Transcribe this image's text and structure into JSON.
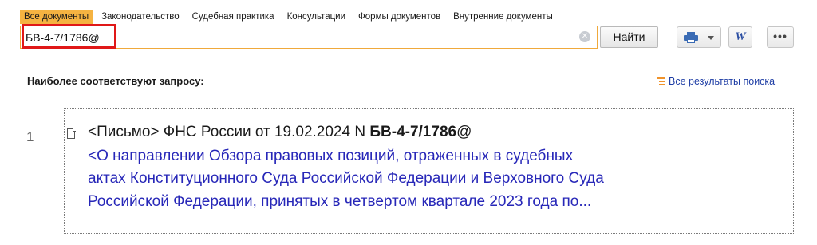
{
  "tabs": [
    {
      "label": "Все документы",
      "active": true
    },
    {
      "label": "Законодательство",
      "active": false
    },
    {
      "label": "Судебная практика",
      "active": false
    },
    {
      "label": "Консультации",
      "active": false
    },
    {
      "label": "Формы документов",
      "active": false
    },
    {
      "label": "Внутренние документы",
      "active": false
    }
  ],
  "search": {
    "value": "БВ-4-7/1786@",
    "button_label": "Найти",
    "clear_symbol": "✕"
  },
  "toolbar": {
    "print_icon": "printer-icon",
    "word_icon_label": "W",
    "more_label": "•••"
  },
  "results": {
    "section_title": "Наиболее соответствуют запросу:",
    "all_results_label": "Все результаты поиска",
    "items": [
      {
        "number": "1",
        "title_prefix": "<Письмо> ФНС России от 19.02.2024 N ",
        "title_bold": "БВ-4-7/1786",
        "title_suffix": "@",
        "description_lines": [
          "<О направлении Обзора правовых позиций, отраженных в судебных",
          "актах Конституционного Суда Российской Федерации и Верховного Суда",
          "Российской Федерации, принятых в четвертом квартале 2023 года по..."
        ]
      }
    ]
  },
  "colors": {
    "accent": "#f5b341",
    "highlight": "#e01818",
    "link": "#2727b8"
  }
}
